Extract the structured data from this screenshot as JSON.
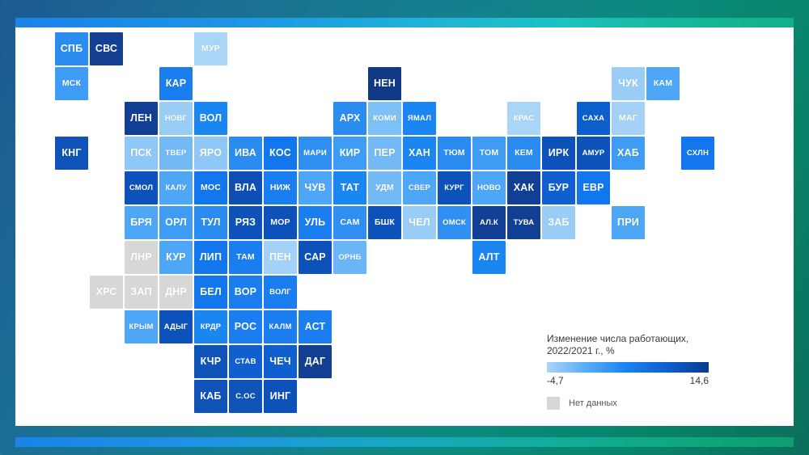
{
  "legend": {
    "title_line1": "Изменение числа работающих,",
    "title_line2": "2022/2021 г., %",
    "min_label": "-4,7",
    "max_label": "14,6",
    "nodata_label": "Нет данных",
    "gradient_start": "#a9d5f7",
    "gradient_end": "#0a3a8f",
    "nodata_color": "#d7d7d7"
  },
  "chart_data": {
    "type": "heatmap",
    "title": "Изменение числа работающих, 2022/2021 г., %",
    "xlabel": "",
    "ylabel": "",
    "value_range": [
      -4.7,
      14.6
    ],
    "nodata_label": "Нет данных",
    "colorscale": [
      "#a9d5f7",
      "#5fb0f5",
      "#1b84f2",
      "#0f5fd0",
      "#0a3a8f"
    ],
    "note": "Tile cartogram of Russian regions; col/row are grid cells, value is % change",
    "tiles": [
      {
        "code": "СПБ",
        "col": 0,
        "row": 0,
        "color": "#2a8cf0"
      },
      {
        "code": "СВС",
        "col": 1,
        "row": 0,
        "color": "#143f93"
      },
      {
        "code": "МУР",
        "col": 4,
        "row": 0,
        "color": "#a9d5f7"
      },
      {
        "code": "МСК",
        "col": 0,
        "row": 1,
        "color": "#3f9cf5"
      },
      {
        "code": "КАР",
        "col": 3,
        "row": 1,
        "color": "#1a7ef0"
      },
      {
        "code": "НЕН",
        "col": 9,
        "row": 1,
        "color": "#103a86"
      },
      {
        "code": "ЧУК",
        "col": 16,
        "row": 1,
        "color": "#9acdf6"
      },
      {
        "code": "КАМ",
        "col": 17,
        "row": 1,
        "color": "#4ea6f6"
      },
      {
        "code": "ЛЕН",
        "col": 2,
        "row": 2,
        "color": "#123f93"
      },
      {
        "code": "НОВГ",
        "col": 3,
        "row": 2,
        "color": "#9acdf6"
      },
      {
        "code": "ВОЛ",
        "col": 4,
        "row": 2,
        "color": "#1a86f2"
      },
      {
        "code": "АРХ",
        "col": 8,
        "row": 2,
        "color": "#2a8cf0"
      },
      {
        "code": "КОМИ",
        "col": 9,
        "row": 2,
        "color": "#7cc0f6"
      },
      {
        "code": "ЯМАЛ",
        "col": 10,
        "row": 2,
        "color": "#1a86f2"
      },
      {
        "code": "КРАС",
        "col": 13,
        "row": 2,
        "color": "#a9d5f7"
      },
      {
        "code": "САХА",
        "col": 15,
        "row": 2,
        "color": "#0d5fcc"
      },
      {
        "code": "МАГ",
        "col": 16,
        "row": 2,
        "color": "#a3d1f7"
      },
      {
        "code": "КНГ",
        "col": 0,
        "row": 3,
        "color": "#0f52b8"
      },
      {
        "code": "ПСК",
        "col": 2,
        "row": 3,
        "color": "#8fc8f6"
      },
      {
        "code": "ТВЕР",
        "col": 3,
        "row": 3,
        "color": "#73b9f6"
      },
      {
        "code": "ЯРО",
        "col": 4,
        "row": 3,
        "color": "#8fc8f6"
      },
      {
        "code": "ИВА",
        "col": 5,
        "row": 3,
        "color": "#2a8cf0"
      },
      {
        "code": "КОС",
        "col": 6,
        "row": 3,
        "color": "#1277ee"
      },
      {
        "code": "МАРИ",
        "col": 7,
        "row": 3,
        "color": "#2f90f2"
      },
      {
        "code": "КИР",
        "col": 8,
        "row": 3,
        "color": "#3f9cf5"
      },
      {
        "code": "ПЕР",
        "col": 9,
        "row": 3,
        "color": "#73b9f6"
      },
      {
        "code": "ХАН",
        "col": 10,
        "row": 3,
        "color": "#1a86f2"
      },
      {
        "code": "ТЮМ",
        "col": 11,
        "row": 3,
        "color": "#2a8cf0"
      },
      {
        "code": "ТОМ",
        "col": 12,
        "row": 3,
        "color": "#3f9cf5"
      },
      {
        "code": "КЕМ",
        "col": 13,
        "row": 3,
        "color": "#2a8cf0"
      },
      {
        "code": "ИРК",
        "col": 14,
        "row": 3,
        "color": "#0d52bb"
      },
      {
        "code": "АМУР",
        "col": 15,
        "row": 3,
        "color": "#0d52bb"
      },
      {
        "code": "ХАБ",
        "col": 16,
        "row": 3,
        "color": "#3f9cf5"
      },
      {
        "code": "СХЛН",
        "col": 18,
        "row": 3,
        "color": "#1277ee"
      },
      {
        "code": "СМОЛ",
        "col": 2,
        "row": 4,
        "color": "#0d52bb"
      },
      {
        "code": "КАЛУ",
        "col": 3,
        "row": 4,
        "color": "#4ea6f6"
      },
      {
        "code": "МОС",
        "col": 4,
        "row": 4,
        "color": "#1277ee"
      },
      {
        "code": "ВЛА",
        "col": 5,
        "row": 4,
        "color": "#0d4fb2"
      },
      {
        "code": "НИЖ",
        "col": 6,
        "row": 4,
        "color": "#1a7ef0"
      },
      {
        "code": "ЧУВ",
        "col": 7,
        "row": 4,
        "color": "#4ea6f6"
      },
      {
        "code": "ТАТ",
        "col": 8,
        "row": 4,
        "color": "#1a86f2"
      },
      {
        "code": "УДМ",
        "col": 9,
        "row": 4,
        "color": "#73b9f6"
      },
      {
        "code": "СВЕР",
        "col": 10,
        "row": 4,
        "color": "#4ea6f6"
      },
      {
        "code": "КУРГ",
        "col": 11,
        "row": 4,
        "color": "#0d52bb"
      },
      {
        "code": "НОВО",
        "col": 12,
        "row": 4,
        "color": "#4ea6f6"
      },
      {
        "code": "ХАК",
        "col": 13,
        "row": 4,
        "color": "#103f93"
      },
      {
        "code": "БУР",
        "col": 14,
        "row": 4,
        "color": "#0f5fd0"
      },
      {
        "code": "ЕВР",
        "col": 15,
        "row": 4,
        "color": "#1277ee"
      },
      {
        "code": "БРЯ",
        "col": 2,
        "row": 5,
        "color": "#4ea6f6"
      },
      {
        "code": "ОРЛ",
        "col": 3,
        "row": 5,
        "color": "#3f9cf5"
      },
      {
        "code": "ТУЛ",
        "col": 4,
        "row": 5,
        "color": "#2a8cf0"
      },
      {
        "code": "РЯЗ",
        "col": 5,
        "row": 5,
        "color": "#0d52bb"
      },
      {
        "code": "МОР",
        "col": 6,
        "row": 5,
        "color": "#0d52bb"
      },
      {
        "code": "УЛЬ",
        "col": 7,
        "row": 5,
        "color": "#1a7ef0"
      },
      {
        "code": "САМ",
        "col": 8,
        "row": 5,
        "color": "#2f90f2"
      },
      {
        "code": "БШК",
        "col": 9,
        "row": 5,
        "color": "#0d52bb"
      },
      {
        "code": "ЧЕЛ",
        "col": 10,
        "row": 5,
        "color": "#9acdf6"
      },
      {
        "code": "ОМСК",
        "col": 11,
        "row": 5,
        "color": "#2f90f2"
      },
      {
        "code": "АЛ.К",
        "col": 12,
        "row": 5,
        "color": "#103f93"
      },
      {
        "code": "ТУВА",
        "col": 13,
        "row": 5,
        "color": "#103f93"
      },
      {
        "code": "ЗАБ",
        "col": 14,
        "row": 5,
        "color": "#9acdf6"
      },
      {
        "code": "ПРИ",
        "col": 16,
        "row": 5,
        "color": "#4ea6f6"
      },
      {
        "code": "ЛНР",
        "col": 2,
        "row": 6,
        "color": "#d7d7d7",
        "nodata": true
      },
      {
        "code": "КУР",
        "col": 3,
        "row": 6,
        "color": "#4ea6f6"
      },
      {
        "code": "ЛИП",
        "col": 4,
        "row": 6,
        "color": "#1277ee"
      },
      {
        "code": "ТАМ",
        "col": 5,
        "row": 6,
        "color": "#1a7ef0"
      },
      {
        "code": "ПЕН",
        "col": 6,
        "row": 6,
        "color": "#a3d1f7"
      },
      {
        "code": "САР",
        "col": 7,
        "row": 6,
        "color": "#0d52bb"
      },
      {
        "code": "ОРНБ",
        "col": 8,
        "row": 6,
        "color": "#6ab5f6"
      },
      {
        "code": "АЛТ",
        "col": 12,
        "row": 6,
        "color": "#1a86f2"
      },
      {
        "code": "ХРС",
        "col": 1,
        "row": 7,
        "color": "#d7d7d7",
        "nodata": true
      },
      {
        "code": "ЗАП",
        "col": 2,
        "row": 7,
        "color": "#d7d7d7",
        "nodata": true
      },
      {
        "code": "ДНР",
        "col": 3,
        "row": 7,
        "color": "#d7d7d7",
        "nodata": true
      },
      {
        "code": "БЕЛ",
        "col": 4,
        "row": 7,
        "color": "#1277ee"
      },
      {
        "code": "ВОР",
        "col": 5,
        "row": 7,
        "color": "#1a7ef0"
      },
      {
        "code": "ВОЛГ",
        "col": 6,
        "row": 7,
        "color": "#1a7ef0"
      },
      {
        "code": "КРЫМ",
        "col": 2,
        "row": 8,
        "color": "#4ea6f6"
      },
      {
        "code": "АДЫГ",
        "col": 3,
        "row": 8,
        "color": "#0d52bb"
      },
      {
        "code": "КРДР",
        "col": 4,
        "row": 8,
        "color": "#1a86f2"
      },
      {
        "code": "РОС",
        "col": 5,
        "row": 8,
        "color": "#1a7ef0"
      },
      {
        "code": "КАЛМ",
        "col": 6,
        "row": 8,
        "color": "#1a7ef0"
      },
      {
        "code": "АСТ",
        "col": 7,
        "row": 8,
        "color": "#1a7ef0"
      },
      {
        "code": "КЧР",
        "col": 4,
        "row": 9,
        "color": "#0f52b8"
      },
      {
        "code": "СТАВ",
        "col": 5,
        "row": 9,
        "color": "#0f5fd0"
      },
      {
        "code": "ЧЕЧ",
        "col": 6,
        "row": 9,
        "color": "#0f5fd0"
      },
      {
        "code": "ДАГ",
        "col": 7,
        "row": 9,
        "color": "#123f93"
      },
      {
        "code": "КАБ",
        "col": 4,
        "row": 10,
        "color": "#0f52b8"
      },
      {
        "code": "С.ОС",
        "col": 5,
        "row": 10,
        "color": "#0f52b8"
      },
      {
        "code": "ИНГ",
        "col": 6,
        "row": 10,
        "color": "#0d52bb"
      }
    ]
  }
}
